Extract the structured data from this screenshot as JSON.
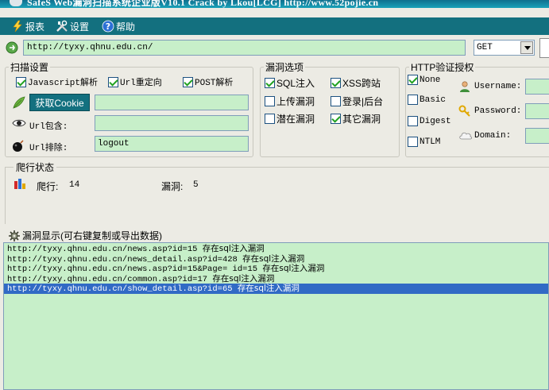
{
  "window": {
    "title": "SafeS Web漏洞扫描系统企业版V10.1 Crack by Lkou[LCG] http://www.52pojie.cn"
  },
  "menu": [
    {
      "label": "报表",
      "icon": "lightning-icon"
    },
    {
      "label": "设置",
      "icon": "tools-icon"
    },
    {
      "label": "帮助",
      "icon": "help-icon"
    }
  ],
  "url_bar": {
    "value": "http://tyxy.qhnu.edu.cn/",
    "method": "GET"
  },
  "scan_settings": {
    "legend": "扫描设置",
    "javascript_label": "Javascript解析",
    "javascript_checked": true,
    "url_redirect_label": "Url重定向",
    "url_redirect_checked": true,
    "post_parse_label": "POST解析",
    "post_parse_checked": true,
    "cookie_button": "获取Cookie",
    "cookie_value": "",
    "url_include_label": "Url包含:",
    "url_include_value": "",
    "url_exclude_label": "Url排除:",
    "url_exclude_value": "logout"
  },
  "vuln_options": {
    "legend": "漏洞选项",
    "items": [
      {
        "label": "SQL注入",
        "checked": true
      },
      {
        "label": "XSS跨站",
        "checked": true
      },
      {
        "label": "上传漏洞",
        "checked": false
      },
      {
        "label": "登录|后台",
        "checked": false
      },
      {
        "label": "潜在漏洞",
        "checked": false
      },
      {
        "label": "其它漏洞",
        "checked": true
      }
    ]
  },
  "http_auth": {
    "legend": "HTTP验证授权",
    "options": [
      {
        "label": "None",
        "checked": true
      },
      {
        "label": "Basic",
        "checked": false
      },
      {
        "label": "Digest",
        "checked": false
      },
      {
        "label": "NTLM",
        "checked": false
      }
    ],
    "username_label": "Username:",
    "password_label": "Password:",
    "domain_label": "Domain:"
  },
  "crawl_status": {
    "title": "爬行状态",
    "crawl_label": "爬行:",
    "crawl_count": "14",
    "vuln_label": "漏洞:",
    "vuln_count": "5"
  },
  "vuln_display": {
    "title": "漏洞显示(可右键复制或导出数据)",
    "rows": [
      {
        "url": "http://tyxy.qhnu.edu.cn/news.asp?id=15",
        "note": "存在sql注入漏洞",
        "selected": false
      },
      {
        "url": "http://tyxy.qhnu.edu.cn/news_detail.asp?id=428",
        "note": "存在sql注入漏洞",
        "selected": false
      },
      {
        "url": "http://tyxy.qhnu.edu.cn/news.asp?id=15&Page= id=15",
        "note": "存在sql注入漏洞",
        "selected": false
      },
      {
        "url": "http://tyxy.qhnu.edu.cn/common.asp?id=17",
        "note": "存在sql注入漏洞",
        "selected": false
      },
      {
        "url": "http://tyxy.qhnu.edu.cn/show_detail.asp?id=65",
        "note": "存在sql注入漏洞",
        "selected": true
      }
    ]
  }
}
